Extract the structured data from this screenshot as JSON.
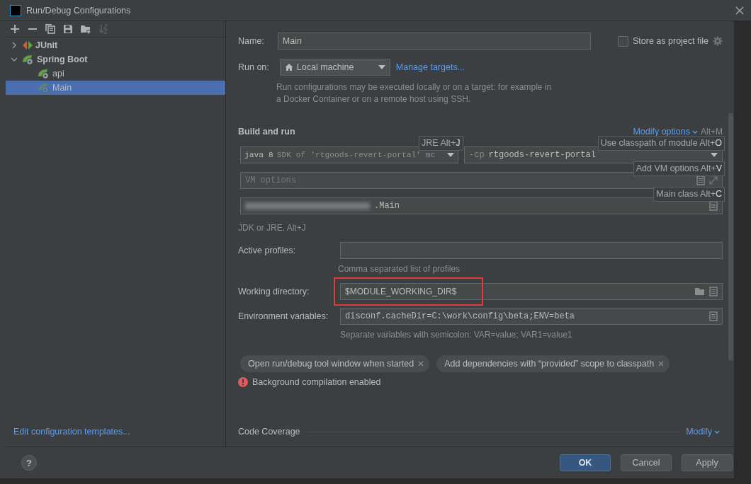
{
  "window": {
    "title": "Run/Debug Configurations"
  },
  "toolbar": [
    {
      "kind": "add",
      "disabled": false
    },
    {
      "kind": "remove",
      "disabled": false
    },
    {
      "kind": "copy",
      "disabled": false
    },
    {
      "kind": "save",
      "disabled": false
    },
    {
      "kind": "folder",
      "disabled": false
    },
    {
      "kind": "sort",
      "disabled": true
    }
  ],
  "tree": [
    {
      "label": "JUnit",
      "kind": "junit",
      "expanded": false,
      "selected": false
    },
    {
      "label": "Spring Boot",
      "kind": "spring",
      "expanded": true,
      "selected": false,
      "children": [
        {
          "label": "api",
          "kind": "spring",
          "selected": false
        },
        {
          "label": "Main",
          "kind": "spring",
          "selected": true
        }
      ]
    }
  ],
  "edit_templates_link": "Edit configuration templates...",
  "name": {
    "label": "Name:",
    "value": "Main"
  },
  "store_as_project_file": {
    "label": "Store as project file",
    "checked": false
  },
  "run_on": {
    "label": "Run on:",
    "value": "Local machine",
    "link": "Manage targets...",
    "hint": "Run configurations may be executed locally or on a target: for example in a Docker Container or on a remote host using SSH."
  },
  "build_and_run": {
    "title": "Build and run",
    "modify_options": "Modify options",
    "modify_shortcut": "Alt+M",
    "jre": {
      "value": "java 8",
      "hint": "SDK of 'rtgoods-revert-portal' mc"
    },
    "classpath": {
      "prefix": "-cp",
      "value": "rtgoods-revert-portal"
    },
    "vm_options": {
      "placeholder": "VM options"
    },
    "main_class": {
      "value": ".Main"
    },
    "jdk_hint": "JDK or JRE. Alt+J"
  },
  "popups": [
    {
      "text": "JRE Alt+**J**"
    },
    {
      "text": "Use classpath of module Alt+**O**"
    },
    {
      "text": "Add VM options Alt+**V**"
    },
    {
      "text": "Main class Alt+**C**"
    }
  ],
  "active_profiles": {
    "label": "Active profiles:",
    "hint": "Comma separated list of profiles"
  },
  "working_directory": {
    "label": "Working directory:",
    "value": "$MODULE_WORKING_DIR$",
    "highlighted": true
  },
  "environment_variables": {
    "label": "Environment variables:",
    "value": "disconf.cacheDir=C:\\work\\config\\beta;ENV=beta",
    "hint": "Separate variables with semicolon: VAR=value; VAR1=value1"
  },
  "chips": [
    "Open run/debug tool window when started",
    "Add dependencies with “provided” scope to classpath"
  ],
  "warning": "Background compilation enabled",
  "code_coverage": {
    "title": "Code Coverage",
    "modify": "Modify"
  },
  "help": "?",
  "buttons": [
    {
      "label": "OK",
      "kind": "default"
    },
    {
      "label": "Cancel",
      "kind": "normal"
    },
    {
      "label": "Apply",
      "kind": "normal"
    }
  ]
}
